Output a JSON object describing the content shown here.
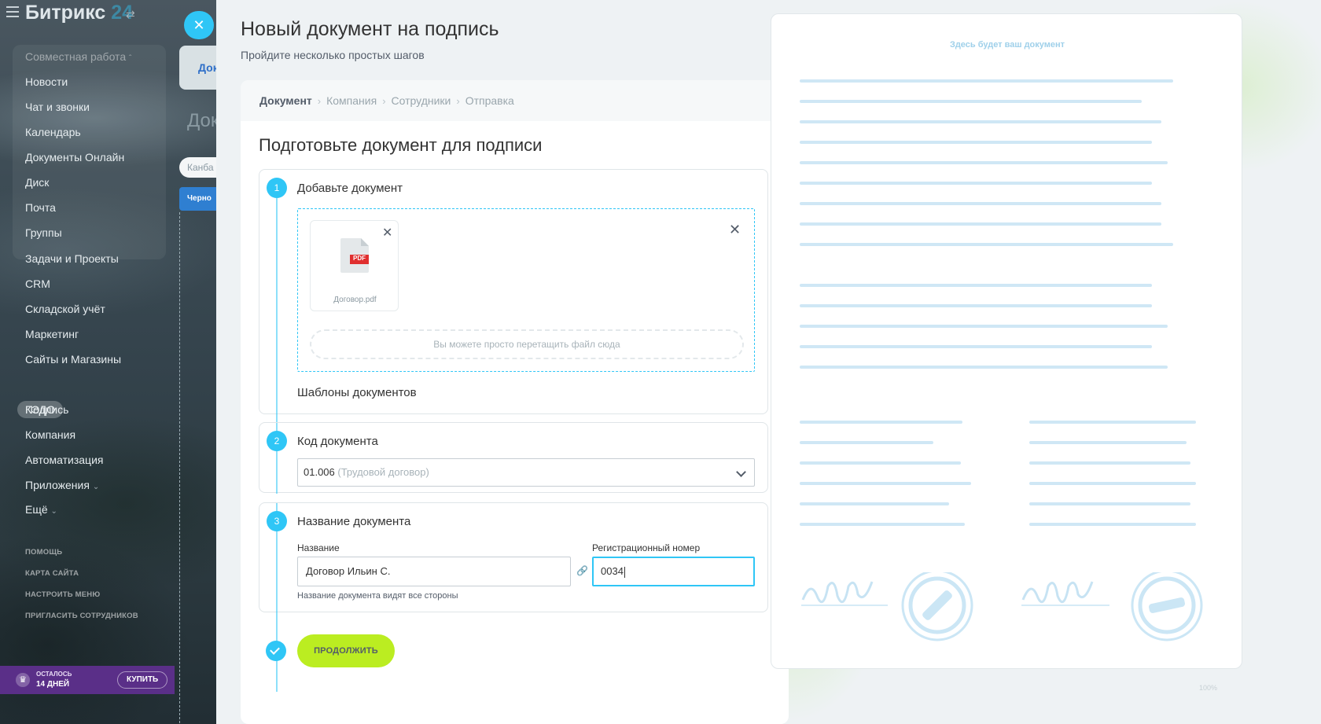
{
  "sidebar": {
    "logo_main": "Битрикс",
    "logo_num": "24",
    "group_header": "Совместная работа",
    "group_items": [
      "Новости",
      "Чат и звонки",
      "Календарь",
      "Документы Онлайн",
      "Диск",
      "Почта",
      "Группы"
    ],
    "items": [
      "Задачи и Проекты",
      "CRM",
      "Складской учёт",
      "Маркетинг",
      "Сайты и Магазины"
    ],
    "active_item": "КЭДО",
    "sub_items": [
      "Подпись",
      "Компания",
      "Автоматизация",
      "Приложения",
      "Ещё"
    ],
    "small_links": [
      "ПОМОЩЬ",
      "КАРТА САЙТА",
      "НАСТРОИТЬ МЕНЮ",
      "ПРИГЛАСИТЬ СОТРУДНИКОВ"
    ],
    "trial_line1": "ОСТАЛОСЬ",
    "trial_line2": "14 ДНЕЙ",
    "buy_label": "КУПИТЬ"
  },
  "background_page": {
    "tab_label": "Док",
    "title": "Док",
    "filter_label": "Канба",
    "pill_label": "Черно"
  },
  "slider": {
    "title": "Новый документ на подпись",
    "subtitle": "Пройдите несколько простых шагов",
    "breadcrumbs": [
      "Документ",
      "Компания",
      "Сотрудники",
      "Отправка"
    ],
    "section_title": "Подготовьте документ для подписи",
    "step1": {
      "number": "1",
      "label": "Добавьте документ",
      "file_name": "Договор.pdf",
      "file_badge": "PDF",
      "drop_hint": "Вы можете просто перетащить файл сюда",
      "templates_label": "Шаблоны документов"
    },
    "step2": {
      "number": "2",
      "label": "Код документа",
      "select_value": "01.006",
      "select_hint": "(Трудовой договор)"
    },
    "step3": {
      "number": "3",
      "label": "Название документа",
      "name_label": "Название",
      "name_value": "Договор Ильин С.",
      "reg_label": "Регистрационный номер",
      "reg_value": "0034",
      "name_hint": "Название документа видят все стороны"
    },
    "continue_label": "ПРОДОЛЖИТЬ",
    "preview_title": "Здесь будет ваш документ",
    "zoom_label": "100%"
  },
  "colors": {
    "accent": "#2fc6f6",
    "button": "#bbed21",
    "preview_lines": "#cfe7f5",
    "trial_bg": "#5a2f88"
  }
}
